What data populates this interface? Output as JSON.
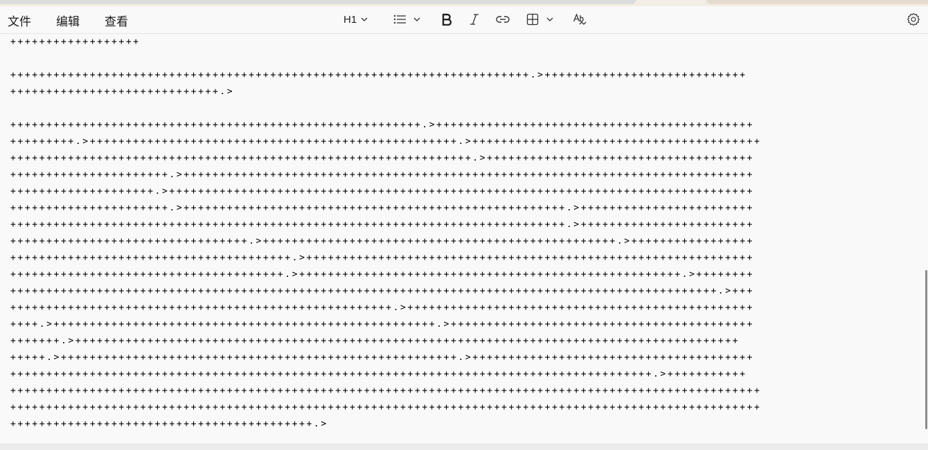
{
  "menu": {
    "file": "文件",
    "edit": "编辑",
    "view": "查看"
  },
  "toolbar": {
    "heading_label": "H1",
    "icons": [
      "chevron-down-icon",
      "list-icon",
      "bold-icon",
      "italic-icon",
      "link-icon",
      "table-icon",
      "clear-format-icon",
      "gear-icon"
    ]
  },
  "document": {
    "lines": [
      "++++++++++++++++++",
      "",
      "++++++++++++++++++++++++++++++++++++++++++++++++++++++++++++++++++++++++.>++++++++++++++++++++++++++++",
      "+++++++++++++++++++++++++++++.>",
      "",
      "+++++++++++++++++++++++++++++++++++++++++++++++++++++++++.>++++++++++++++++++++++++++++++++++++++++++++",
      "+++++++++.>+++++++++++++++++++++++++++++++++++++++++++++++++++.>++++++++++++++++++++++++++++++++++++++++",
      "++++++++++++++++++++++++++++++++++++++++++++++++++++++++++++++++.>+++++++++++++++++++++++++++++++++++++",
      "++++++++++++++++++++++.>+++++++++++++++++++++++++++++++++++++++++++++++++++++++++++++++++++++++++++++++",
      "++++++++++++++++++++.>+++++++++++++++++++++++++++++++++++++++++++++++++++++++++++++++++++++++++++++++++",
      "++++++++++++++++++++++.>+++++++++++++++++++++++++++++++++++++++++++++++++++++.>++++++++++++++++++++++++",
      "+++++++++++++++++++++++++++++++++++++++++++++++++++++++++++++++++++++++++++++.>++++++++++++++++++++++++",
      "+++++++++++++++++++++++++++++++++.>+++++++++++++++++++++++++++++++++++++++++++++++++.>+++++++++++++++++",
      "+++++++++++++++++++++++++++++++++++++++.>++++++++++++++++++++++++++++++++++++++++++++++++++++++++++++++",
      "++++++++++++++++++++++++++++++++++++++.>+++++++++++++++++++++++++++++++++++++++++++++++++++++.>++++++++",
      "++++++++++++++++++++++++++++++++++++++++++++++++++++++++++++++++++++++++++++++++++++++++++++++++++.>+++",
      "+++++++++++++++++++++++++++++++++++++++++++++++++++++.>++++++++++++++++++++++++++++++++++++++++++++++++",
      "++++.>+++++++++++++++++++++++++++++++++++++++++++++++++++++.>++++++++++++++++++++++++++++++++++++++++++",
      "+++++++.>++++++++++++++++++++++++++++++++++++++++++++++++++++++++++++++++++++++++++++++++++++++++++++",
      "+++++.>+++++++++++++++++++++++++++++++++++++++++++++++++++++++.>+++++++++++++++++++++++++++++++++++++++",
      "+++++++++++++++++++++++++++++++++++++++++++++++++++++++++++++++++++++++++++++++++++++++++.>+++++++++++",
      "++++++++++++++++++++++++++++++++++++++++++++++++++++++++++++++++++++++++++++++++++++++++++++++++++++++++",
      "++++++++++++++++++++++++++++++++++++++++++++++++++++++++++++++++++++++++++++++++++++++++++++++++++++++++",
      "++++++++++++++++++++++++++++++++++++++++++.>"
    ]
  }
}
